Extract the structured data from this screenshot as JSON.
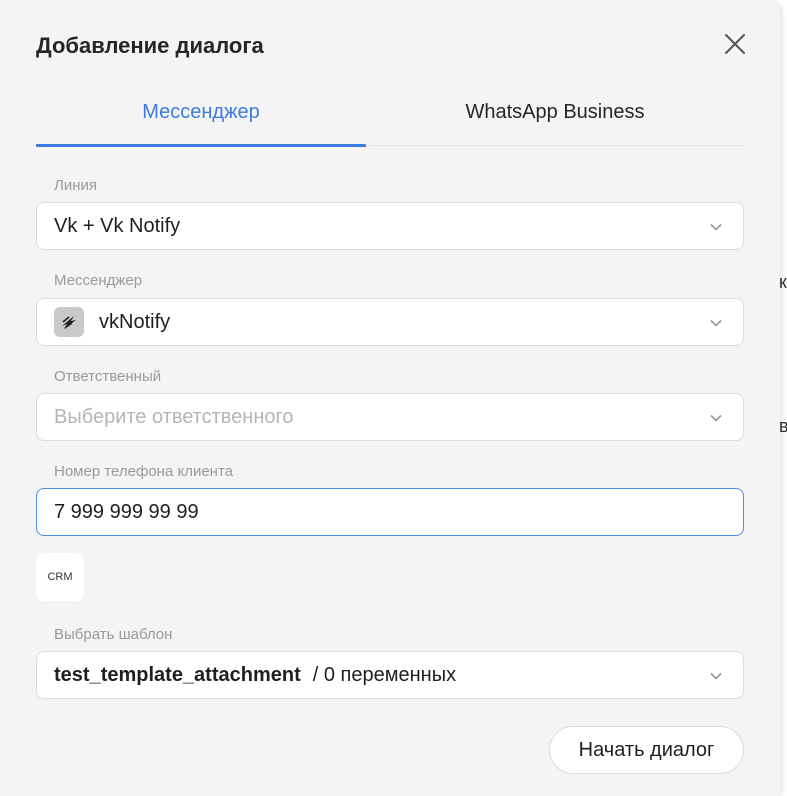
{
  "background": {
    "char_1": "к",
    "char_2": "в"
  },
  "modal": {
    "title": "Добавление диалога",
    "tabs": [
      {
        "label": "Мессенджер",
        "active": true
      },
      {
        "label": "WhatsApp Business",
        "active": false
      }
    ],
    "fields": {
      "line": {
        "label": "Линия",
        "value": "Vk + Vk Notify"
      },
      "messenger": {
        "label": "Мессенджер",
        "value": "vkNotify",
        "icon": "vk-notify-icon"
      },
      "responsible": {
        "label": "Ответственный",
        "placeholder": "Выберите ответственного"
      },
      "phone": {
        "label": "Номер телефона клиента",
        "value": "7 999 999 99 99"
      },
      "crm": {
        "label": "CRM"
      },
      "template": {
        "label": "Выбрать шаблон",
        "name": "test_template_attachment",
        "vars": "/ 0 переменных"
      }
    },
    "start_button": "Начать диалог"
  },
  "colors": {
    "accent": "#3b7be0",
    "modal_bg": "#f4f4f4",
    "input_focus": "#4f8be8"
  }
}
